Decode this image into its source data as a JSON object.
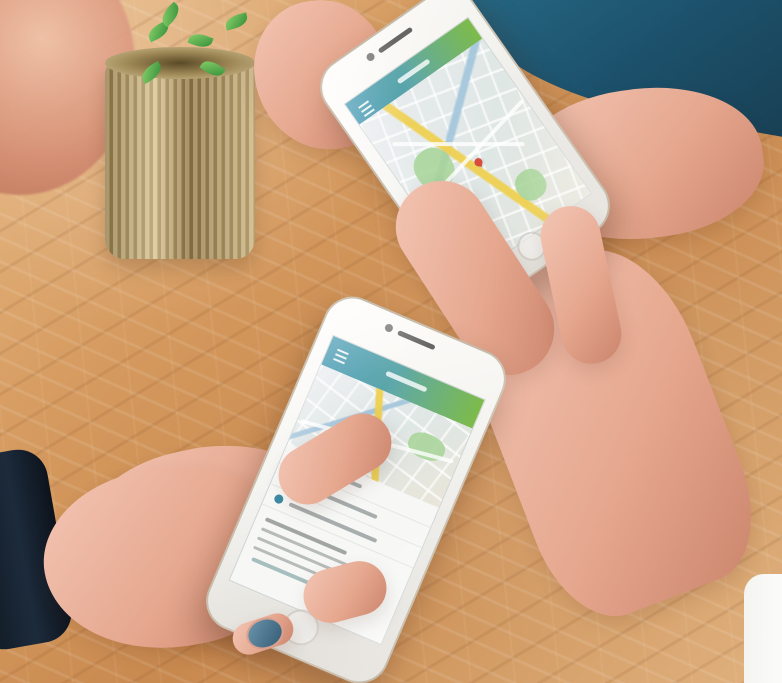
{
  "scene": {
    "subject": "",
    "colors": {
      "table": "#d79f67",
      "app_header_start": "#2f8daa",
      "app_header_end": "#7dbb49",
      "map_background": "#e8eeeb",
      "pin": "#d94b3d"
    }
  },
  "phones": [
    {
      "screen_type": "map",
      "icons": [
        "menu-icon",
        "map-pin-icon"
      ]
    },
    {
      "screen_type": "contact",
      "icons": [
        "menu-icon",
        "map-pin-icon",
        "phone-icon",
        "email-icon",
        "website-icon"
      ]
    }
  ]
}
